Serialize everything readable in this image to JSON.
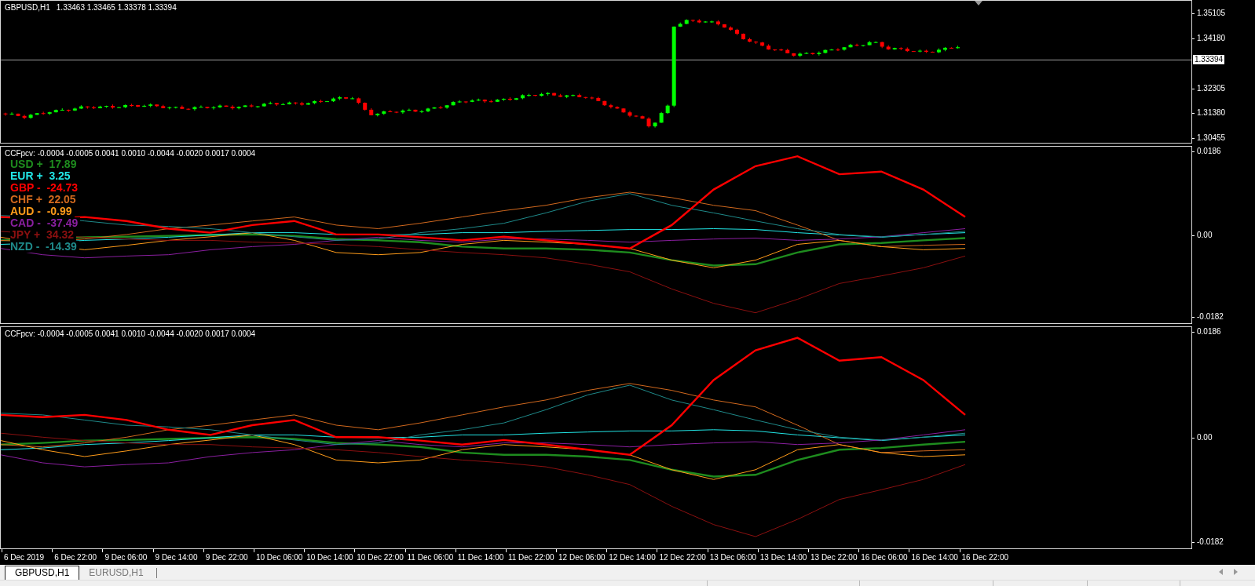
{
  "price_pane": {
    "symbol": "GBPUSD,H1",
    "ohlc": "1.33463 1.33465 1.33378 1.33394",
    "price_ticks": [
      "1.35105",
      "1.34180",
      "1.32305",
      "1.31380",
      "1.30455"
    ],
    "current_price": "1.33394"
  },
  "indicator_panes": [
    {
      "header": "CCFpcv: -0.0004 -0.0005 0.0041 0.0010 -0.0044 -0.0020 0.0017 0.0004",
      "legend": [
        {
          "text": "USD +  17.89",
          "color": "#1e8c1e"
        },
        {
          "text": "EUR +  3.25",
          "color": "#22e6e6"
        },
        {
          "text": "GBP -  -24.73",
          "color": "#ff0000"
        },
        {
          "text": "CHF +  22.05",
          "color": "#d2691e"
        },
        {
          "text": "AUD -  -0.99",
          "color": "#ff9c1a"
        },
        {
          "text": "CAD -  -37.49",
          "color": "#8a1fa0"
        },
        {
          "text": "JPY +  34.32",
          "color": "#8b1010"
        },
        {
          "text": "NZD -  -14.39",
          "color": "#1f8a8a"
        }
      ],
      "axis_ticks": [
        "0.0186",
        "0.00",
        "-0.0182"
      ]
    },
    {
      "header": "CCFpcv: -0.0004 -0.0005 0.0041 0.0010 -0.0044 -0.0020 0.0017 0.0004",
      "axis_ticks": [
        "0.0186",
        "0.00",
        "-0.0182"
      ]
    }
  ],
  "time_axis": [
    "6 Dec 2019",
    "6 Dec 22:00",
    "9 Dec 06:00",
    "9 Dec 14:00",
    "9 Dec 22:00",
    "10 Dec 06:00",
    "10 Dec 14:00",
    "10 Dec 22:00",
    "11 Dec 06:00",
    "11 Dec 14:00",
    "11 Dec 22:00",
    "12 Dec 06:00",
    "12 Dec 14:00",
    "12 Dec 22:00",
    "13 Dec 06:00",
    "13 Dec 14:00",
    "13 Dec 22:00",
    "16 Dec 06:00",
    "16 Dec 14:00",
    "16 Dec 22:00"
  ],
  "tabs": [
    {
      "label": "GBPUSD,H1",
      "selected": true
    },
    {
      "label": "EURUSD,H1",
      "selected": false
    }
  ]
}
